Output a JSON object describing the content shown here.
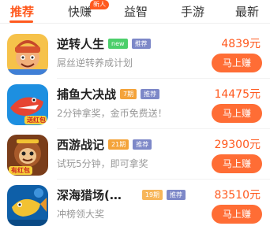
{
  "tabs": [
    {
      "label": "推荐",
      "active": true
    },
    {
      "label": "快赚",
      "badge": "新人"
    },
    {
      "label": "益智"
    },
    {
      "label": "手游"
    },
    {
      "label": "最新"
    }
  ],
  "colors": {
    "accent": "#ff5a1f",
    "button": "#ff6d35",
    "tag_new": "#4ccf6b",
    "tag_rec": "#7d88c8",
    "tag_period": "#f4a33a"
  },
  "apps": [
    {
      "title": "逆转人生",
      "tags": [
        "new",
        "推荐"
      ],
      "subtitle": "屌丝逆转养成计划",
      "reward": "4839元",
      "cta": "马上赚",
      "icon": "cartoon-boy-icon"
    },
    {
      "title": "捕鱼大决战",
      "tags": [
        "7期",
        "推荐"
      ],
      "subtitle": "2分钟拿奖，金币免费送！",
      "reward": "14475元",
      "cta": "马上赚",
      "icon": "shark-red-envelope-icon",
      "icon_text": "送红包"
    },
    {
      "title": "西游战记",
      "tags": [
        "21期",
        "推荐"
      ],
      "subtitle": "试玩5分钟，即可拿奖",
      "reward": "29300元",
      "cta": "马上赚",
      "icon": "monkey-king-icon",
      "icon_text": "有红包"
    },
    {
      "title": "深海猎场(…",
      "tags": [
        "19期",
        "推荐"
      ],
      "subtitle": "冲榜领大奖",
      "reward": "83510元",
      "cta": "马上赚",
      "icon": "deep-sea-fish-icon"
    }
  ]
}
